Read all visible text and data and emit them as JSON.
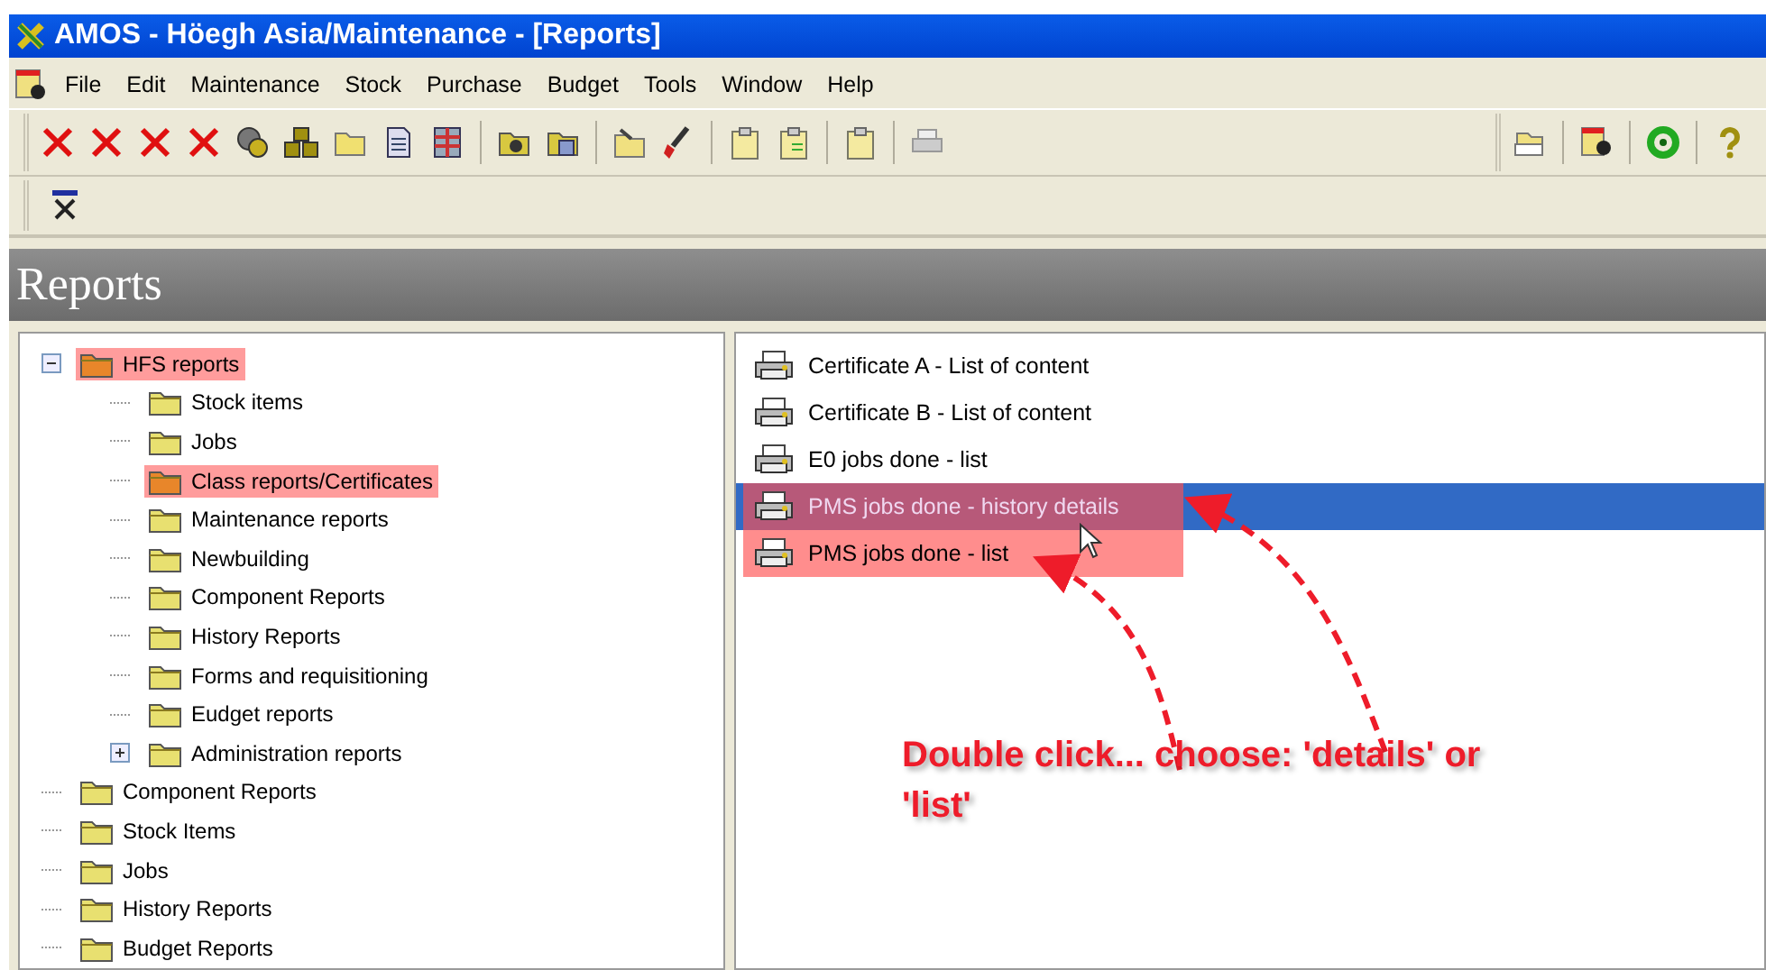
{
  "window": {
    "title": "AMOS - Höegh Asia/Maintenance - [Reports]"
  },
  "menu": [
    "File",
    "Edit",
    "Maintenance",
    "Stock",
    "Purchase",
    "Budget",
    "Tools",
    "Window",
    "Help"
  ],
  "header": {
    "title": "Reports"
  },
  "tree": [
    {
      "label": "HFS reports",
      "expanded": true,
      "highlighted": true,
      "children": [
        {
          "label": "Stock items",
          "highlighted": false
        },
        {
          "label": "Jobs",
          "highlighted": false
        },
        {
          "label": "Class reports/Certificates",
          "highlighted": true
        },
        {
          "label": "Maintenance reports",
          "highlighted": false
        },
        {
          "label": "Newbuilding",
          "highlighted": false
        },
        {
          "label": "Component Reports",
          "highlighted": false
        },
        {
          "label": "History Reports",
          "highlighted": false
        },
        {
          "label": "Forms and requisitioning",
          "highlighted": false
        },
        {
          "label": "Eudget reports",
          "highlighted": false
        },
        {
          "label": "Administration reports",
          "expanded": false,
          "highlighted": false
        }
      ]
    },
    {
      "label": "Component Reports",
      "highlighted": false
    },
    {
      "label": "Stock Items",
      "highlighted": false
    },
    {
      "label": "Jobs",
      "highlighted": false
    },
    {
      "label": "History Reports",
      "highlighted": false
    },
    {
      "label": "Budget Reports",
      "highlighted": false
    }
  ],
  "reports": [
    {
      "label": "Certificate A - List of content",
      "selected": false,
      "highlighted": false
    },
    {
      "label": "Certificate B - List of content",
      "selected": false,
      "highlighted": false
    },
    {
      "label": "E0 jobs done - list",
      "selected": false,
      "highlighted": false
    },
    {
      "label": "PMS jobs done - history details",
      "selected": true,
      "highlighted": true
    },
    {
      "label": "PMS jobs done - list",
      "selected": false,
      "highlighted": true
    }
  ],
  "annotation": {
    "text": "Double click... choose: 'details' or 'list'"
  }
}
